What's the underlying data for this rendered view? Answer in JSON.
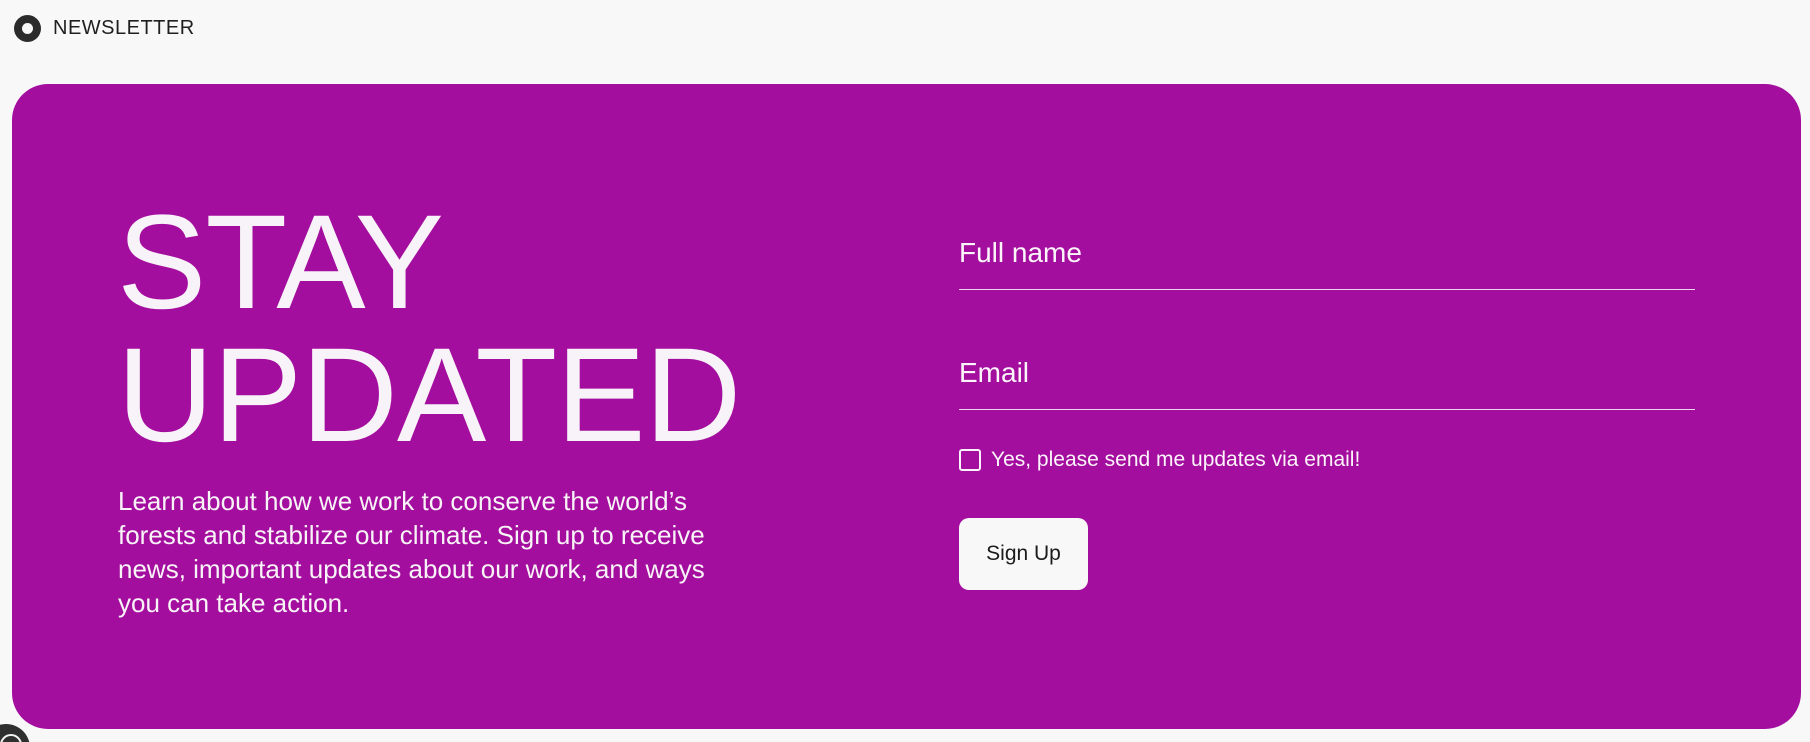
{
  "header": {
    "section_label": "NEWSLETTER",
    "icon": "circle-dot-icon"
  },
  "newsletter": {
    "headline_line1": "STAY",
    "headline_line2": "UPDATED",
    "description": "Learn about how we work to conserve the world’s forests and stabilize our climate. Sign up to receive news, important updates about our work, and ways you can take action.",
    "background_color": "#a40e9e",
    "form": {
      "full_name_placeholder": "Full name",
      "full_name_value": "",
      "email_placeholder": "Email",
      "email_value": "",
      "consent_label": "Yes, please send me updates via email!",
      "consent_checked": false,
      "submit_label": "Sign Up"
    }
  },
  "footer": {
    "corner_icon": "accessibility-badge-icon"
  }
}
